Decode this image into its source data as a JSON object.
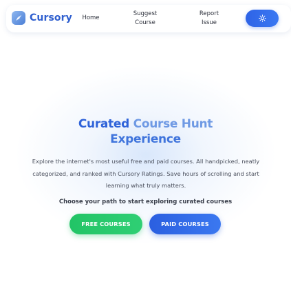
{
  "header": {
    "brand_name": "Cursory",
    "logo_icon": "compass-icon",
    "nav": {
      "home": "Home",
      "suggest_course": "Suggest\nCourse",
      "report_issue": "Report\nIssue"
    },
    "theme_toggle_icon": "sun-icon"
  },
  "hero": {
    "title_part1": "Curated ",
    "title_part2": "Course Hunt",
    "title_part3": "Experience",
    "description": "Explore the internet's most useful free and paid courses. All handpicked, neatly categorized, and ranked with Cursory Ratings. Save hours of scrolling and start learning what truly matters.",
    "cta_text": "Choose your path to start exploring curated courses",
    "buttons": {
      "free": "FREE COURSES",
      "paid": "PAID COURSES"
    }
  },
  "colors": {
    "brand_blue": "#2f5fcf",
    "accent_blue": "#2e63e6",
    "green": "#22c466"
  }
}
